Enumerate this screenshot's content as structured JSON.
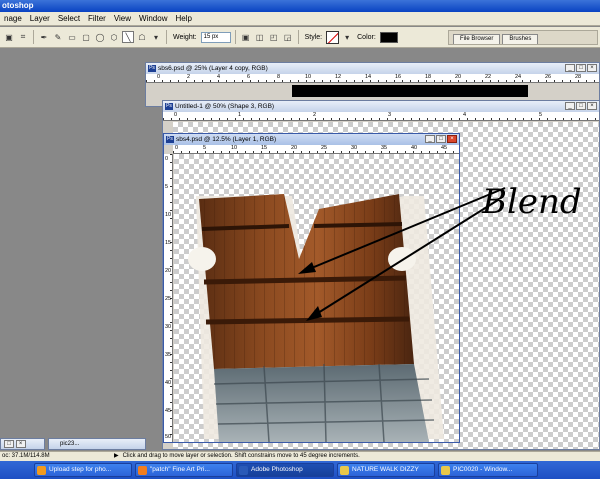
{
  "app": {
    "title": "otoshop"
  },
  "menu": [
    "nage",
    "Layer",
    "Select",
    "Filter",
    "View",
    "Window",
    "Help"
  ],
  "options": {
    "weight_label": "Weight:",
    "weight_value": "15 px",
    "style_label": "Style:",
    "color_label": "Color:",
    "color_value": "#000000",
    "palette_tabs": [
      "File Browser",
      "Brushes"
    ]
  },
  "windows": {
    "back": {
      "title": "sbs6.psd @ 25% (Layer 4 copy, RGB)",
      "ruler": [
        "0",
        "2",
        "4",
        "6",
        "8",
        "10",
        "12",
        "14",
        "16",
        "18",
        "20",
        "22",
        "24",
        "26",
        "28"
      ]
    },
    "middle": {
      "title": "Untitled-1 @ 50% (Shape 3, RGB)",
      "ruler": [
        "0",
        "1",
        "2",
        "3",
        "4",
        "5"
      ]
    },
    "front": {
      "title": "sbs4.psd @ 12.5% (Layer 1, RGB)",
      "ruler_h": [
        "0",
        "5",
        "10",
        "15",
        "20",
        "25",
        "30",
        "35",
        "40",
        "45"
      ],
      "ruler_v": [
        "0",
        "5",
        "10",
        "15",
        "20",
        "25",
        "30",
        "35",
        "40",
        "45",
        "50"
      ]
    }
  },
  "annotation": {
    "text": "Blend"
  },
  "minimized_docs": [
    "pic23..."
  ],
  "status": {
    "doc_info": "oc: 37.1M/114.8M",
    "hint": "Click and drag to move layer or selection. Shift constrains move to 45 degree increments."
  },
  "taskbar": {
    "items": [
      {
        "label": "Upload step for pho...",
        "icon_color": "#f29a1e"
      },
      {
        "label": "\"patch\" Fine Art Pri...",
        "icon_color": "#f27d1e"
      },
      {
        "label": "Adobe Photoshop",
        "icon_color": "#2a5ab8",
        "active": true
      },
      {
        "label": "NATURE WALK DIZZY",
        "icon_color": "#e8c84a"
      },
      {
        "label": "PIC0020 - Window...",
        "icon_color": "#e8c84a"
      }
    ]
  }
}
